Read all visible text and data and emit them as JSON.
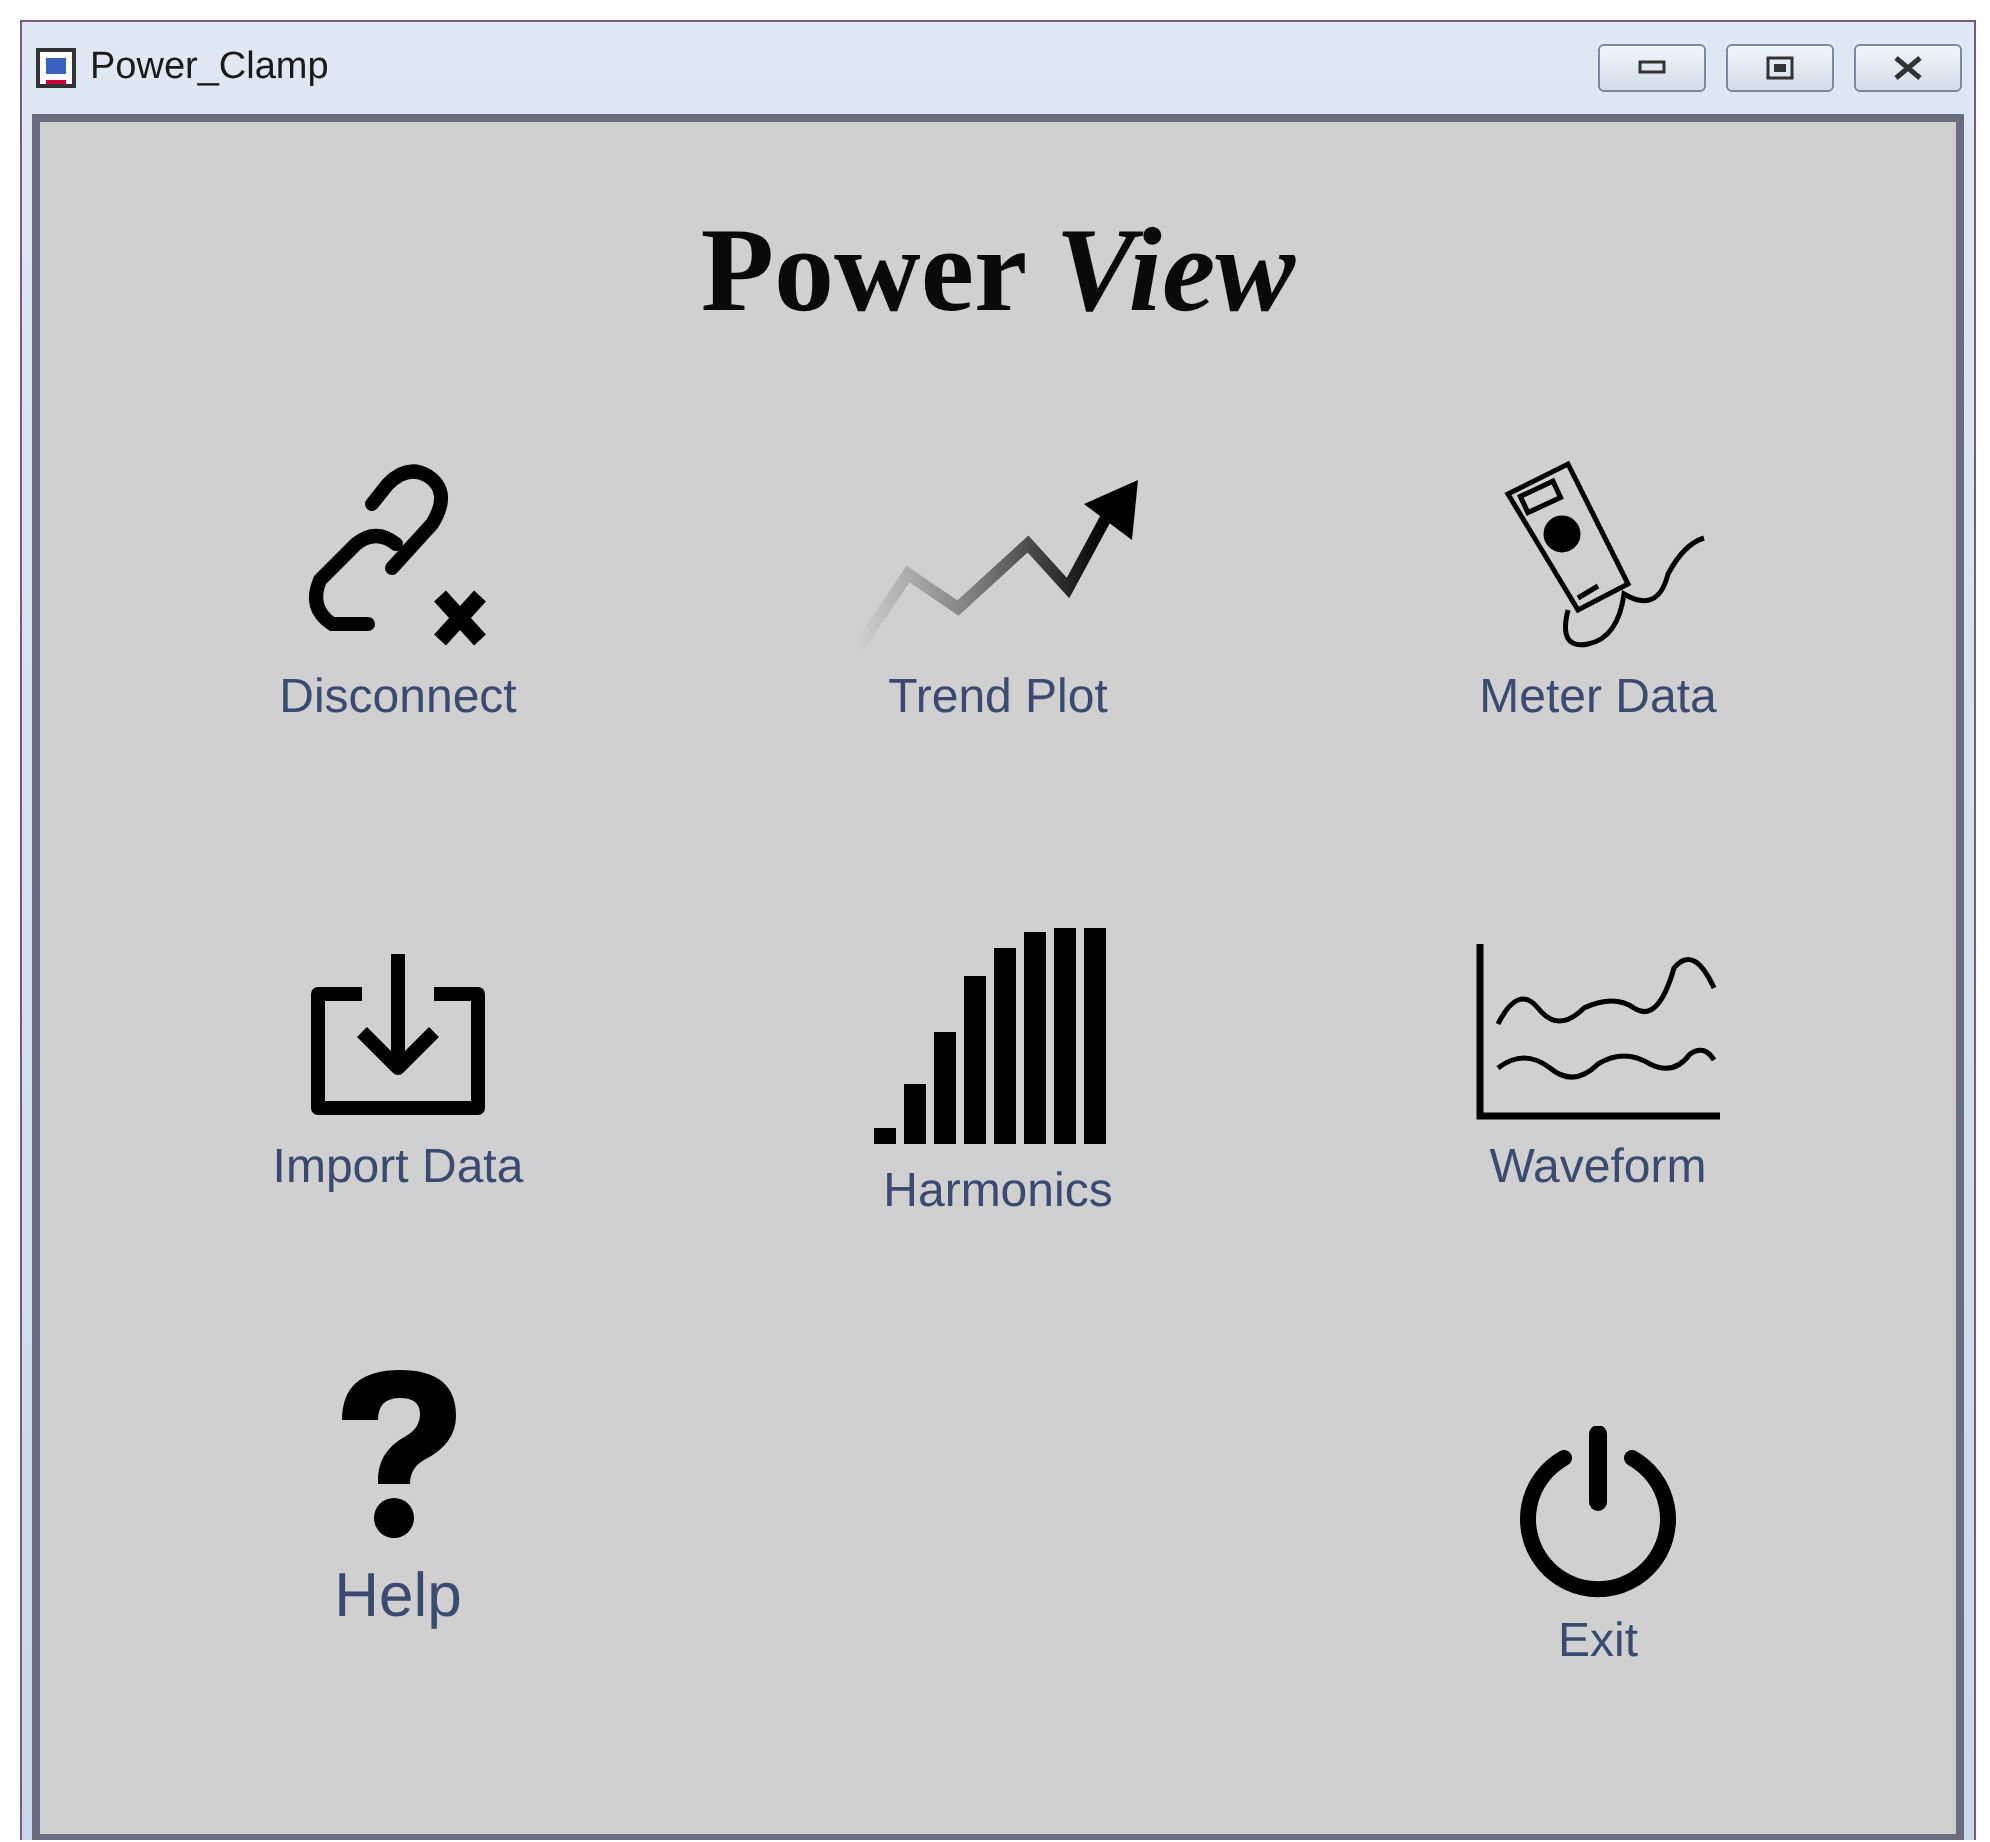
{
  "window": {
    "title": "Power_Clamp"
  },
  "heading": "Power *View*",
  "rows": [
    {
      "buttons": [
        {
          "label": "Disconnect",
          "kind": "disconnect"
        },
        {
          "label": "Trend Plot",
          "kind": "trend"
        },
        {
          "label": "Meter Data",
          "kind": "meter"
        }
      ]
    },
    {
      "buttons": [
        {
          "label": "Import Data",
          "kind": "import"
        },
        {
          "label": "Harmonics",
          "kind": "harmonics"
        },
        {
          "label": "Waveform",
          "kind": "waveform"
        }
      ]
    },
    {
      "buttons": [
        {
          "label": "Help",
          "kind": "help"
        },
        {
          "label": "Exit",
          "kind": "exit"
        }
      ]
    }
  ]
}
